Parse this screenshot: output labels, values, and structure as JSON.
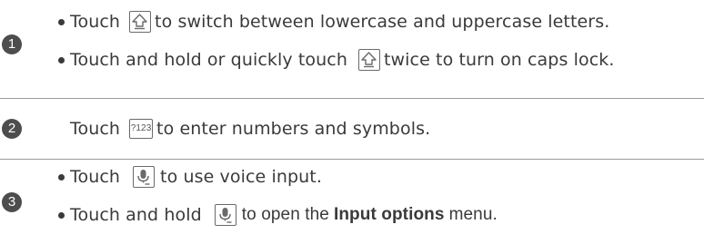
{
  "steps": [
    {
      "number": "1",
      "lines": [
        {
          "pre": "Touch",
          "icon": "shift-icon",
          "post": "to switch between lowercase and uppercase letters."
        },
        {
          "pre": "Touch and hold or quickly touch",
          "icon": "shift-icon",
          "post": "twice to turn on caps lock."
        }
      ]
    },
    {
      "number": "2",
      "lines": [
        {
          "pre": "Touch",
          "icon": "numbers-key-icon",
          "icon_text": "?123",
          "post": "to enter numbers and symbols."
        }
      ]
    },
    {
      "number": "3",
      "lines": [
        {
          "pre": "Touch",
          "icon": "microphone-icon",
          "post": "to use voice input."
        },
        {
          "pre": "Touch and hold",
          "icon": "microphone-icon",
          "post_a": "to open the",
          "bold": "Input options",
          "post_b": "menu."
        }
      ]
    }
  ]
}
